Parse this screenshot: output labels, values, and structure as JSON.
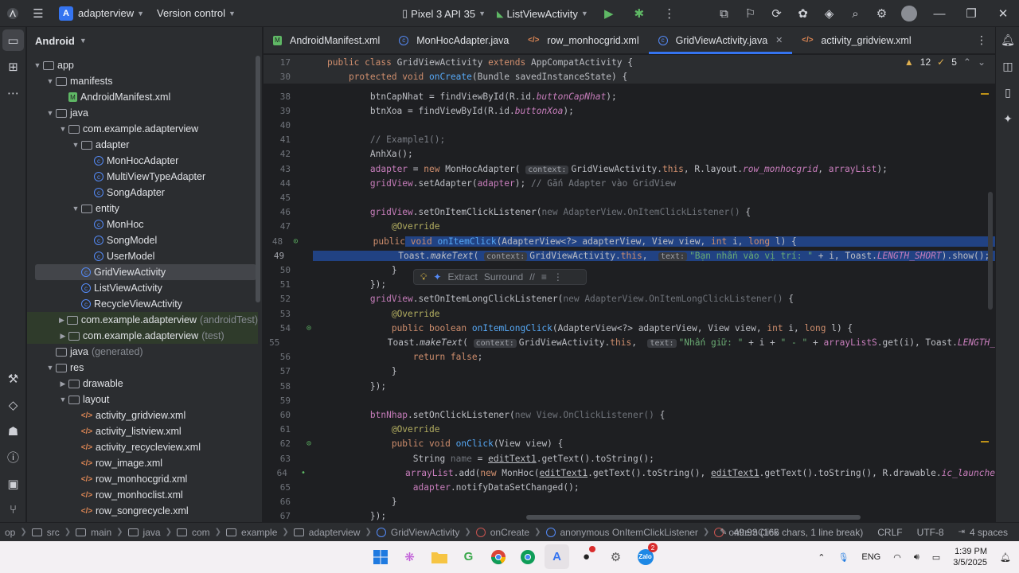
{
  "titlebar": {
    "project_badge": "A",
    "project": "adapterview",
    "vcs": "Version control",
    "device": "Pixel 3 API 35",
    "run_config": "ListViewActivity"
  },
  "project_panel": {
    "title": "Android",
    "tree": [
      {
        "label": "app",
        "depth": 0,
        "icon": "folder",
        "arrow": "down"
      },
      {
        "label": "manifests",
        "depth": 1,
        "icon": "folder",
        "arrow": "down"
      },
      {
        "label": "AndroidManifest.xml",
        "depth": 2,
        "icon": "manifest",
        "arrow": ""
      },
      {
        "label": "java",
        "depth": 1,
        "icon": "folder",
        "arrow": "down"
      },
      {
        "label": "com.example.adapterview",
        "depth": 2,
        "icon": "folder",
        "arrow": "down"
      },
      {
        "label": "adapter",
        "depth": 3,
        "icon": "folder",
        "arrow": "down"
      },
      {
        "label": "MonHocAdapter",
        "depth": 4,
        "icon": "class",
        "arrow": ""
      },
      {
        "label": "MultiViewTypeAdapter",
        "depth": 4,
        "icon": "class",
        "arrow": ""
      },
      {
        "label": "SongAdapter",
        "depth": 4,
        "icon": "class",
        "arrow": ""
      },
      {
        "label": "entity",
        "depth": 3,
        "icon": "folder",
        "arrow": "down"
      },
      {
        "label": "MonHoc",
        "depth": 4,
        "icon": "class",
        "arrow": ""
      },
      {
        "label": "SongModel",
        "depth": 4,
        "icon": "class",
        "arrow": ""
      },
      {
        "label": "UserModel",
        "depth": 4,
        "icon": "class",
        "arrow": ""
      },
      {
        "label": "GridViewActivity",
        "depth": 3,
        "icon": "class",
        "arrow": "",
        "selected": true
      },
      {
        "label": "ListViewActivity",
        "depth": 3,
        "icon": "class",
        "arrow": ""
      },
      {
        "label": "RecycleViewActivity",
        "depth": 3,
        "icon": "class",
        "arrow": ""
      },
      {
        "label": "com.example.adapterview",
        "suffix": "(androidTest)",
        "depth": 2,
        "icon": "folder",
        "arrow": "right",
        "green": true
      },
      {
        "label": "com.example.adapterview",
        "suffix": "(test)",
        "depth": 2,
        "icon": "folder",
        "arrow": "right",
        "green": true
      },
      {
        "label": "java",
        "suffix": "(generated)",
        "depth": 1,
        "icon": "folder",
        "arrow": ""
      },
      {
        "label": "res",
        "depth": 1,
        "icon": "folder",
        "arrow": "down"
      },
      {
        "label": "drawable",
        "depth": 2,
        "icon": "folder",
        "arrow": "right"
      },
      {
        "label": "layout",
        "depth": 2,
        "icon": "folder",
        "arrow": "down"
      },
      {
        "label": "activity_gridview.xml",
        "depth": 3,
        "icon": "xml",
        "arrow": ""
      },
      {
        "label": "activity_listview.xml",
        "depth": 3,
        "icon": "xml",
        "arrow": ""
      },
      {
        "label": "activity_recycleview.xml",
        "depth": 3,
        "icon": "xml",
        "arrow": ""
      },
      {
        "label": "row_image.xml",
        "depth": 3,
        "icon": "xml",
        "arrow": ""
      },
      {
        "label": "row_monhocgrid.xml",
        "depth": 3,
        "icon": "xml",
        "arrow": ""
      },
      {
        "label": "row_monhoclist.xml",
        "depth": 3,
        "icon": "xml",
        "arrow": ""
      },
      {
        "label": "row_songrecycle.xml",
        "depth": 3,
        "icon": "xml",
        "arrow": ""
      }
    ]
  },
  "tabs": [
    {
      "label": "AndroidManifest.xml",
      "icon": "manifest"
    },
    {
      "label": "MonHocAdapter.java",
      "icon": "class"
    },
    {
      "label": "row_monhocgrid.xml",
      "icon": "xml"
    },
    {
      "label": "GridViewActivity.java",
      "icon": "class",
      "active": true
    },
    {
      "label": "activity_gridview.xml",
      "icon": "xml"
    }
  ],
  "editor": {
    "warnings": "12",
    "weak_warnings": "5",
    "popup": {
      "extract": "Extract",
      "surround": "Surround"
    },
    "sticky_lines": [
      {
        "n": "17",
        "html": "<span class=\"kw\">public class</span> GridViewActivity <span class=\"kw\">extends</span> AppCompatActivity {"
      },
      {
        "n": "30",
        "html": "    <span class=\"kw\">protected void</span> <span class=\"fn\">onCreate</span>(Bundle savedInstanceState) {"
      }
    ],
    "lines": [
      {
        "n": "38",
        "html": "        btnCapNhat = findViewById(R.id.<span class=\"fld\">buttonCapNhat</span>);"
      },
      {
        "n": "39",
        "html": "        btnXoa = findViewById(R.id.<span class=\"fld\">buttonXoa</span>);"
      },
      {
        "n": "40",
        "html": ""
      },
      {
        "n": "41",
        "html": "        <span class=\"cm\">// Example1();</span>"
      },
      {
        "n": "42",
        "html": "        AnhXa();"
      },
      {
        "n": "43",
        "html": "        <span class=\"loc\">adapter</span> = <span class=\"kw\">new</span> MonHocAdapter( <span class=\"hint\">context:</span>GridViewActivity.<span class=\"kw\">this</span>, R.layout.<span class=\"fld\">row_monhocgrid</span>, <span class=\"loc\">arrayList</span>);"
      },
      {
        "n": "44",
        "html": "        <span class=\"loc\">gridView</span>.setAdapter(<span class=\"loc\">adapter</span>); <span class=\"cm\">// Gắn Adapter vào GridView</span>"
      },
      {
        "n": "45",
        "html": ""
      },
      {
        "n": "46",
        "html": "        <span class=\"loc\">gridView</span>.setOnItemClickListener(<span class=\"muted2\">new AdapterView.OnItemClickListener()</span> {"
      },
      {
        "n": "47",
        "html": "            <span class=\"an\">@Override</span>"
      },
      {
        "n": "48",
        "html": "            <span class=\"kw\">public</span><span class=\"hl\"> <span class=\"kw\">void</span> <span class=\"fn\">onItemClick</span>(AdapterView&lt;?&gt; adapterView, View view, <span class=\"kw\">int</span> i, <span class=\"kw\">long</span> l) {                                     </span>",
        "gutter": "⊙"
      },
      {
        "n": "49",
        "html": "<span class=\"hl\">                Toast.<span style=\"font-style:italic\">makeText</span>( <span class=\"hint\">context:</span>GridViewActivity.<span class=\"kw\">this</span>,  <span class=\"hint\">text:</span><span class=\"str\">\"Bạn nhấn vào vị trí: \"</span> + i, Toast.<span class=\"fld\">LENGTH_SHORT</span>).show(); </span>",
        "current": true
      },
      {
        "n": "50",
        "html": "            }"
      },
      {
        "n": "51",
        "html": "        });"
      },
      {
        "n": "52",
        "html": "        <span class=\"loc\">gridView</span>.setOnItemLongClickListener(<span class=\"muted2\">new AdapterView.OnItemLongClickListener()</span> {"
      },
      {
        "n": "53",
        "html": "            <span class=\"an\">@Override</span>"
      },
      {
        "n": "54",
        "html": "            <span class=\"kw\">public boolean</span> <span class=\"fn\">onItemLongClick</span>(AdapterView&lt;?&gt; adapterView, View view, <span class=\"kw\">int</span> i, <span class=\"kw\">long</span> l) {",
        "gutter": "⊙"
      },
      {
        "n": "55",
        "html": "                Toast.<span style=\"font-style:italic\">makeText</span>( <span class=\"hint\">context:</span>GridViewActivity.<span class=\"kw\">this</span>,  <span class=\"hint\">text:</span><span class=\"str\">\"Nhấn giữ: \"</span> + i + <span class=\"str\">\" - \"</span> + <span class=\"loc\">arrayListS</span>.get(i), Toast.<span class=\"fld\">LENGTH_</span>"
      },
      {
        "n": "56",
        "html": "                <span class=\"kw\">return false</span>;"
      },
      {
        "n": "57",
        "html": "            }"
      },
      {
        "n": "58",
        "html": "        });"
      },
      {
        "n": "59",
        "html": ""
      },
      {
        "n": "60",
        "html": "        <span class=\"loc\">btnNhap</span>.setOnClickListener(<span class=\"muted2\">new View.OnClickListener()</span> {"
      },
      {
        "n": "61",
        "html": "            <span class=\"an\">@Override</span>"
      },
      {
        "n": "62",
        "html": "            <span class=\"kw\">public void</span> <span class=\"fn\">onClick</span>(View view) {",
        "gutter": "⊙"
      },
      {
        "n": "63",
        "html": "                String <span class=\"muted2\">name</span> = <span class=\"loc ul\">editText1</span>.getText().toString();"
      },
      {
        "n": "64",
        "html": "                <span class=\"loc\">arrayList</span>.add(<span class=\"kw\">new</span> MonHoc(<span class=\"loc ul\">editText1</span>.getText().toString(), <span class=\"loc ul\">editText1</span>.getText().toString(), R.drawable.<span class=\"fld\">ic_launche</span>",
        "gutter": "•"
      },
      {
        "n": "65",
        "html": "                <span class=\"loc\">adapter</span>.notifyDataSetChanged();"
      },
      {
        "n": "66",
        "html": "            }"
      },
      {
        "n": "67",
        "html": "        });"
      }
    ]
  },
  "statusbar": {
    "crumbs": [
      "op",
      "src",
      "main",
      "java",
      "com",
      "example",
      "adapterview",
      "GridViewActivity",
      "onCreate",
      "anonymous OnItemClickListener",
      "onItemClick"
    ],
    "position": "49:93 (166 chars, 1 line break)",
    "line_sep": "CRLF",
    "encoding": "UTF-8",
    "indent": "4 spaces"
  },
  "taskbar": {
    "lang": "ENG",
    "time": "1:39 PM",
    "date": "3/5/2025",
    "zalo_badge": "2"
  }
}
